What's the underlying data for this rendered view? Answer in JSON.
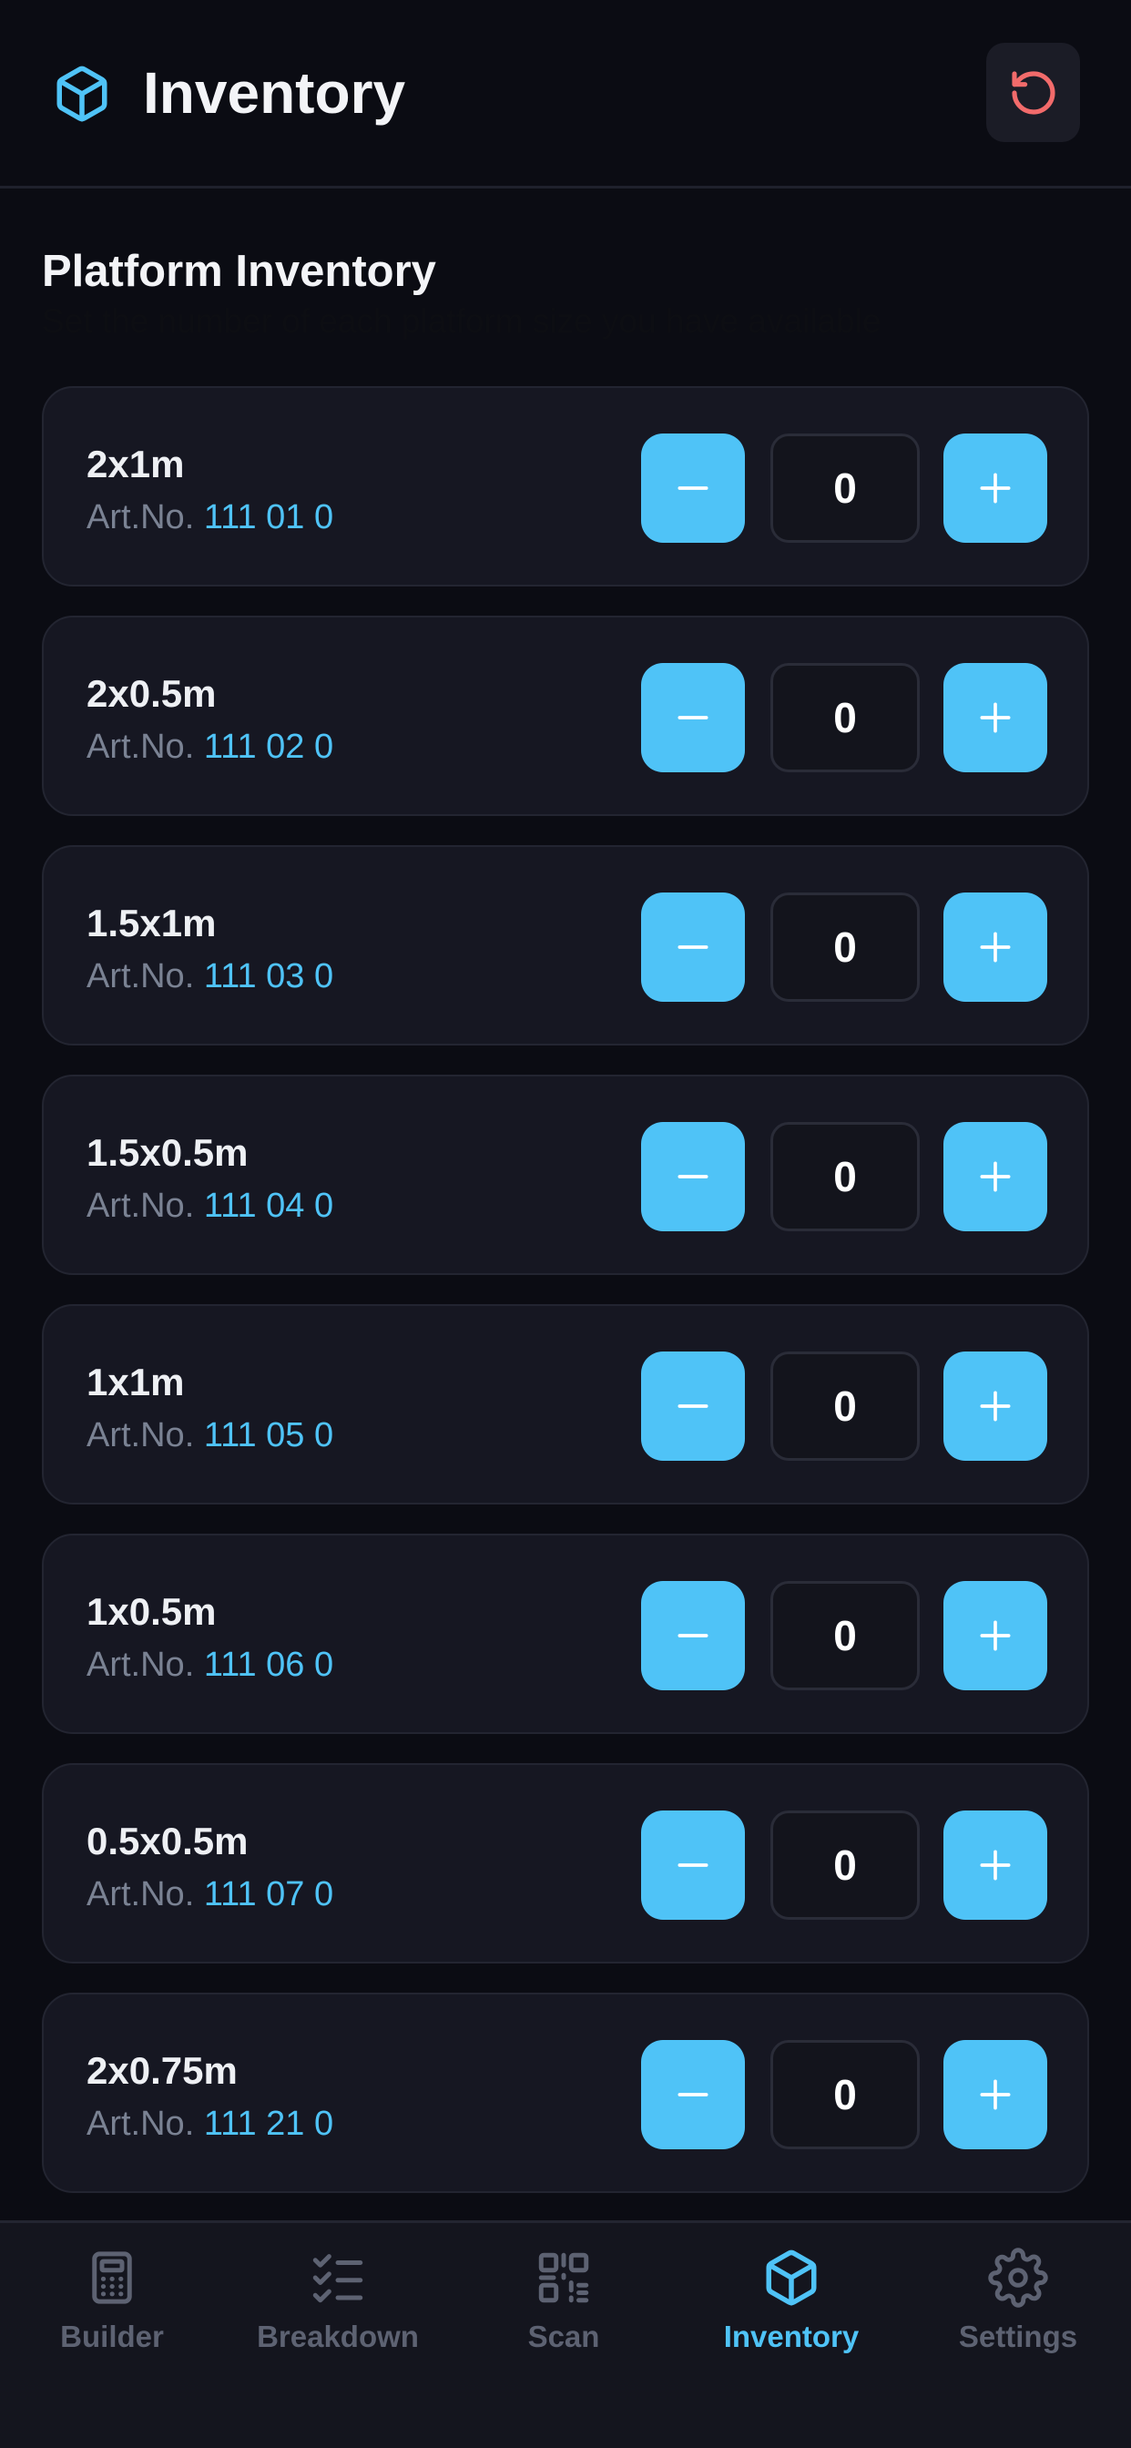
{
  "header": {
    "title": "Inventory",
    "logo_icon": "cube-icon",
    "reset_icon": "rotate-ccw-icon"
  },
  "section": {
    "title": "Platform Inventory",
    "subtitle": "Set the number of each platform size you have available"
  },
  "platforms": [
    {
      "name": "2x1m",
      "art_prefix": "Art.No.",
      "art_number": "111 01 0",
      "quantity": "0"
    },
    {
      "name": "2x0.5m",
      "art_prefix": "Art.No.",
      "art_number": "111 02 0",
      "quantity": "0"
    },
    {
      "name": "1.5x1m",
      "art_prefix": "Art.No.",
      "art_number": "111 03 0",
      "quantity": "0"
    },
    {
      "name": "1.5x0.5m",
      "art_prefix": "Art.No.",
      "art_number": "111 04 0",
      "quantity": "0"
    },
    {
      "name": "1x1m",
      "art_prefix": "Art.No.",
      "art_number": "111 05 0",
      "quantity": "0"
    },
    {
      "name": "1x0.5m",
      "art_prefix": "Art.No.",
      "art_number": "111 06 0",
      "quantity": "0"
    },
    {
      "name": "0.5x0.5m",
      "art_prefix": "Art.No.",
      "art_number": "111 07 0",
      "quantity": "0"
    },
    {
      "name": "2x0.75m",
      "art_prefix": "Art.No.",
      "art_number": "111 21 0",
      "quantity": "0"
    }
  ],
  "nav": {
    "items": [
      {
        "label": "Builder",
        "icon": "calculator-icon",
        "active": false
      },
      {
        "label": "Breakdown",
        "icon": "checklist-icon",
        "active": false
      },
      {
        "label": "Scan",
        "icon": "qr-code-icon",
        "active": false
      },
      {
        "label": "Inventory",
        "icon": "cube-icon",
        "active": true
      },
      {
        "label": "Settings",
        "icon": "gear-icon",
        "active": false
      }
    ]
  },
  "colors": {
    "background": "#0b0c13",
    "card": "#161722",
    "accent": "#4fc3f7",
    "reset": "#f26b6b",
    "muted": "#7a8293",
    "nav_inactive": "#5d6272"
  }
}
